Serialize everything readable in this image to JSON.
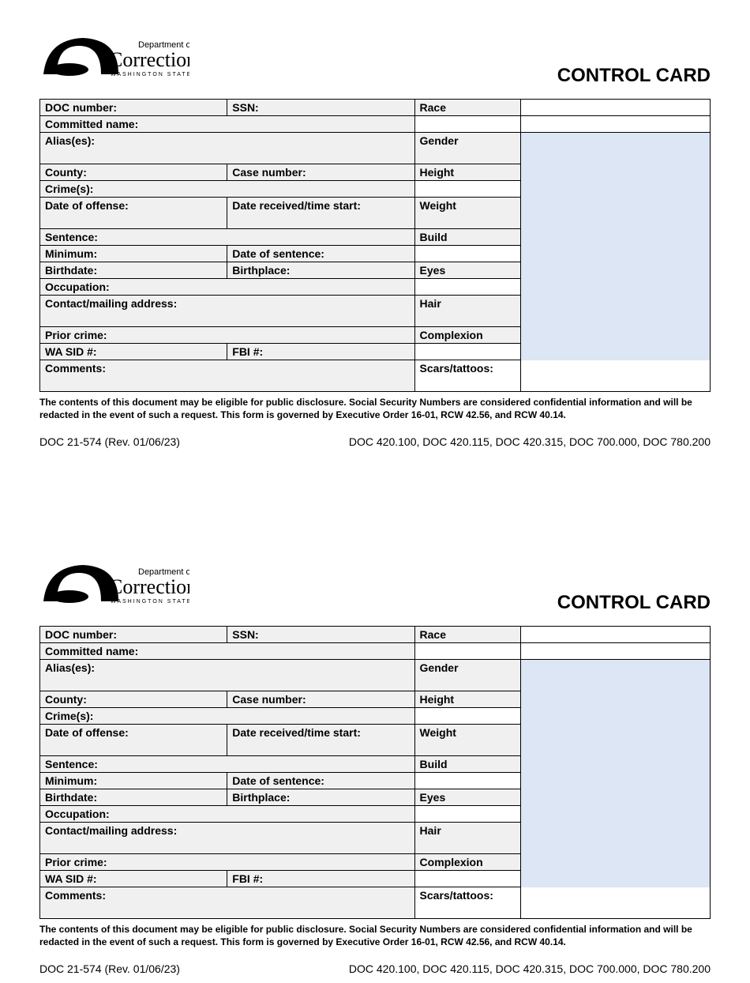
{
  "logo": {
    "dept": "Department of",
    "name": "Corrections",
    "state": "WASHINGTON STATE"
  },
  "title": "CONTROL CARD",
  "fields": {
    "doc_number": "DOC number:",
    "ssn": "SSN:",
    "race": "Race",
    "committed_name": "Committed name:",
    "aliases": "Alias(es):",
    "gender": "Gender",
    "county": "County:",
    "case_number": "Case number:",
    "height": "Height",
    "crimes": "Crime(s):",
    "date_offense": "Date of offense:",
    "date_received": "Date received/time start:",
    "weight": "Weight",
    "sentence": "Sentence:",
    "build": "Build",
    "minimum": "Minimum:",
    "date_sentence": "Date of sentence:",
    "birthdate": "Birthdate:",
    "birthplace": "Birthplace:",
    "eyes": "Eyes",
    "occupation": "Occupation:",
    "contact": "Contact/mailing address:",
    "hair": "Hair",
    "prior_crime": "Prior crime:",
    "complexion": "Complexion",
    "wa_sid": "WA SID #:",
    "fbi": "FBI #:",
    "comments": "Comments:",
    "scars": "Scars/tattoos:"
  },
  "disclaimer": "The contents of this document may be eligible for public disclosure.  Social Security Numbers are considered confidential information and will be redacted in the event of such a request.  This form is governed by Executive Order 16-01, RCW 42.56, and RCW 40.14.",
  "footer_left": "DOC 21-574 (Rev. 01/06/23)",
  "footer_right": "DOC 420.100, DOC 420.115, DOC 420.315, DOC 700.000, DOC 780.200"
}
